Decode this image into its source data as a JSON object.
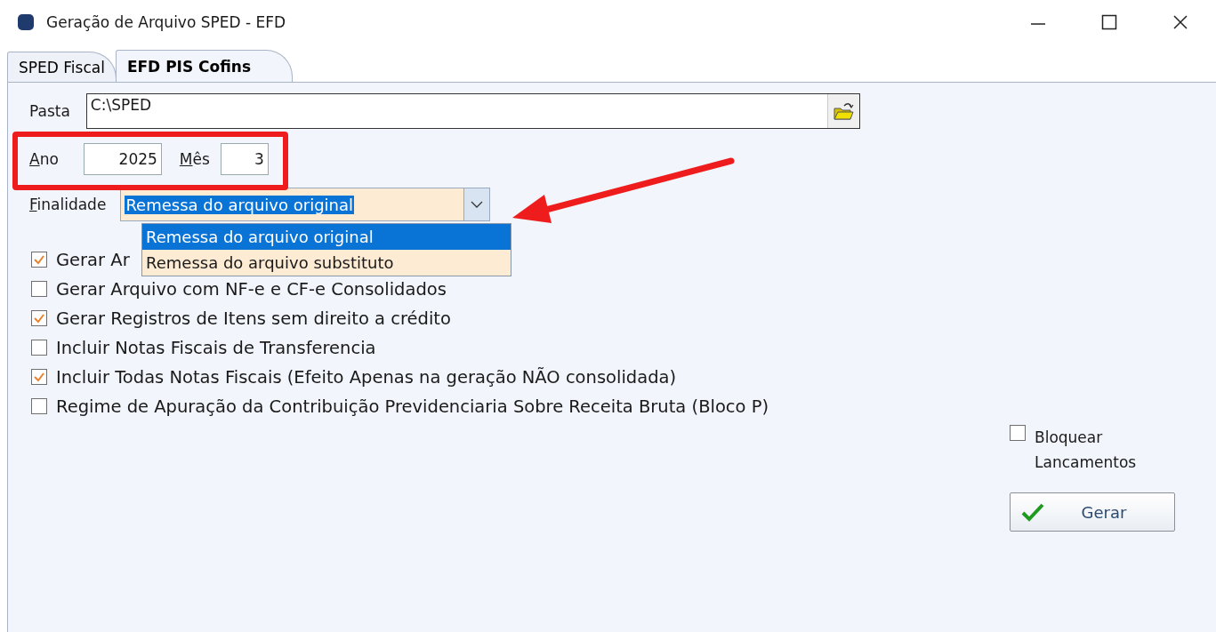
{
  "window": {
    "title": "Geração de Arquivo SPED - EFD"
  },
  "tabs": [
    {
      "label": "SPED Fiscal",
      "selected": false
    },
    {
      "label": "EFD PIS Cofins",
      "selected": true
    }
  ],
  "folder": {
    "label": "Pasta",
    "value": "C:\\SPED"
  },
  "year": {
    "label": "Ano",
    "value": "2025"
  },
  "month": {
    "label": "Mês",
    "value": "3"
  },
  "purpose": {
    "label": "Finalidade",
    "value": "Remessa do arquivo original",
    "expanded": true,
    "options": [
      {
        "label": "Remessa do arquivo original",
        "selected": true
      },
      {
        "label": "Remessa do arquivo substituto",
        "selected": false
      }
    ]
  },
  "options": [
    {
      "label": "Gerar Ar",
      "checked": true
    },
    {
      "label": "Gerar Arquivo com NF-e e CF-e Consolidados",
      "checked": false
    },
    {
      "label": "Gerar Registros de Itens sem direito a crédito",
      "checked": true
    },
    {
      "label": "Incluir Notas Fiscais de Transferencia",
      "checked": false
    },
    {
      "label": "Incluir Todas Notas Fiscais (Efeito Apenas na geração NÃO consolidada)",
      "checked": true
    },
    {
      "label": "Regime de Apuração da Contribuição Previdenciaria Sobre Receita Bruta (Bloco P)",
      "checked": false
    }
  ],
  "lock": {
    "label": "Bloquear Lancamentos",
    "checked": false
  },
  "generate_button": {
    "label": "Gerar"
  }
}
